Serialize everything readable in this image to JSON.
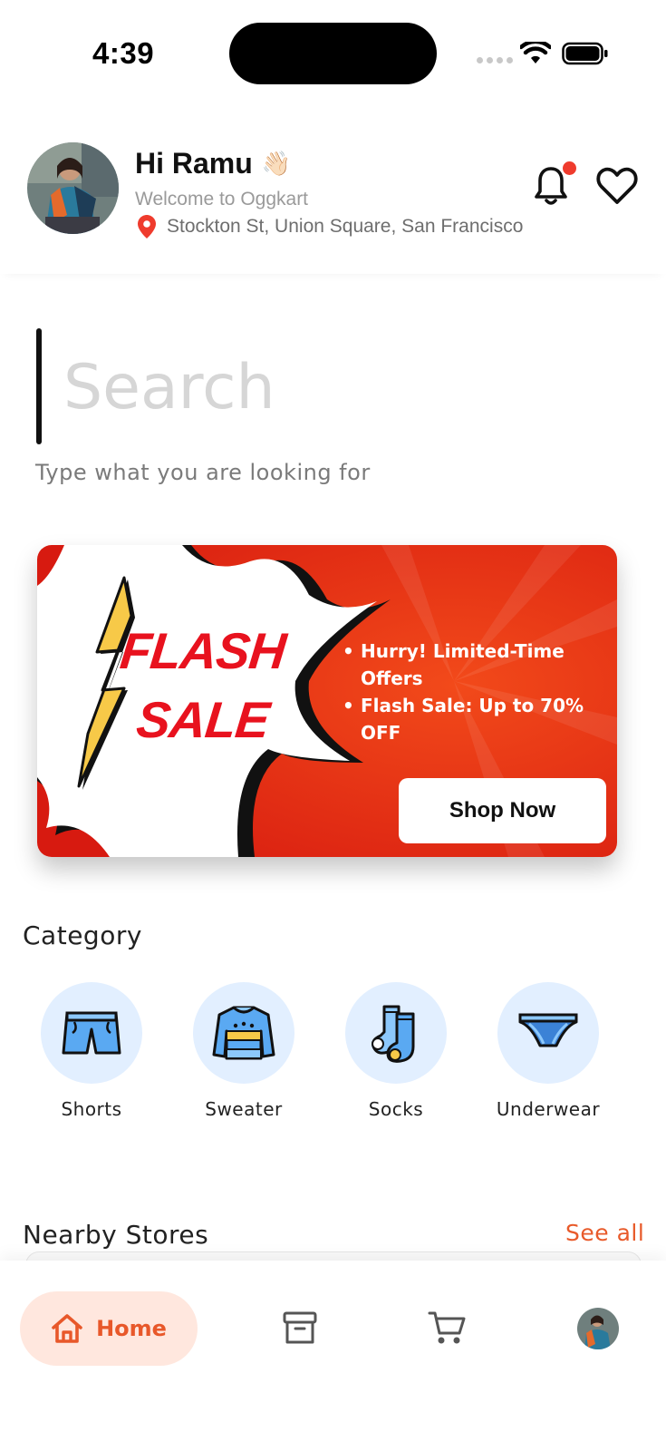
{
  "status_bar": {
    "time": "4:39"
  },
  "header": {
    "greeting": "Hi Ramu",
    "wave_emoji": "👋🏻",
    "welcome": "Welcome to Oggkart",
    "location": "Stockton St, Union Square, San Francisco",
    "notification_dot_color": "#ef3b2d"
  },
  "search": {
    "placeholder": "Search",
    "hint": "Type what you are looking for"
  },
  "banner": {
    "flash_line1": "FLASH",
    "flash_line2": "SALE",
    "offers": [
      "Hurry! Limited-Time Offers",
      "Flash Sale: Up to 70% OFF"
    ],
    "cta": "Shop Now",
    "accent_color": "#e8121e"
  },
  "category": {
    "title": "Category",
    "items": [
      {
        "label": "Shorts",
        "icon": "shorts-icon"
      },
      {
        "label": "Sweater",
        "icon": "sweater-icon"
      },
      {
        "label": "Socks",
        "icon": "socks-icon"
      },
      {
        "label": "Underwear",
        "icon": "underwear-icon"
      }
    ]
  },
  "nearby": {
    "title": "Nearby Stores",
    "see_all": "See all"
  },
  "bottom_nav": {
    "home_label": "Home",
    "active_color": "#e8582a",
    "items": [
      "home-icon",
      "archive-icon",
      "cart-icon",
      "profile-avatar"
    ]
  }
}
